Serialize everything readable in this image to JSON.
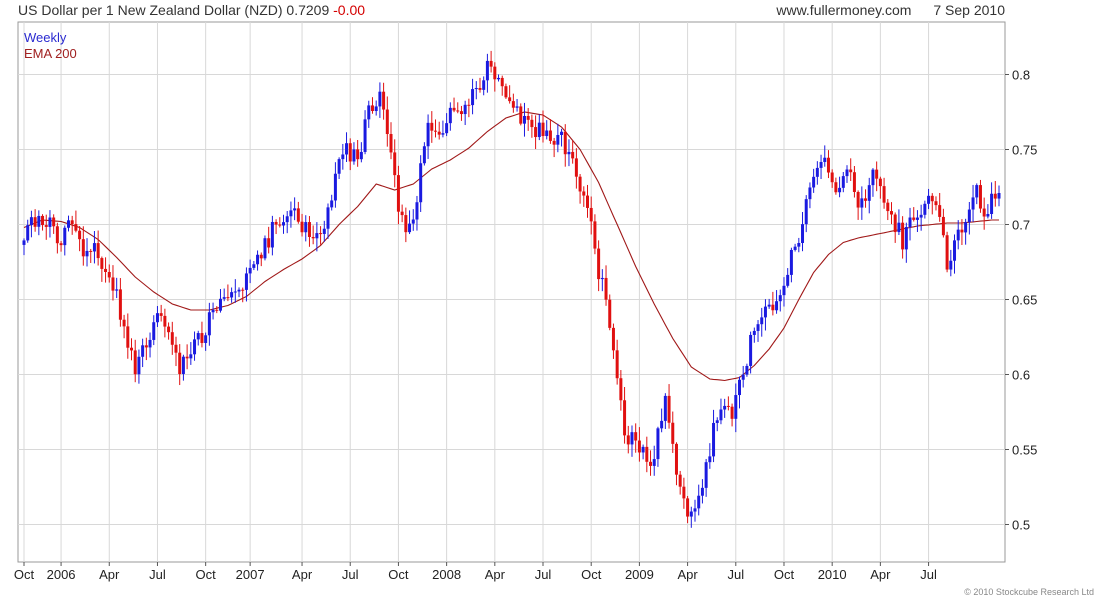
{
  "header": {
    "title_main": "US Dollar per 1 New Zealand Dollar (NZD) 0.7209",
    "title_change": "-0.00",
    "site": "www.fullermoney.com",
    "date": "7 Sep 2010"
  },
  "footer": {
    "copyright": "© 2010 Stockcube Research Ltd"
  },
  "colors": {
    "up": "#1a1ae0",
    "down": "#e01010",
    "ema": "#a01818",
    "grid": "#d8d8d8"
  },
  "chart_data": {
    "type": "candlestick",
    "legend": [
      "Weekly",
      "EMA 200"
    ],
    "ylim": [
      0.475,
      0.835
    ],
    "yticks": [
      0.5,
      0.55,
      0.6,
      0.65,
      0.7,
      0.75,
      0.8
    ],
    "ytick_labels": [
      "0.5",
      "0.55",
      "0.6",
      "0.65",
      "0.7",
      "0.75",
      "0.8"
    ],
    "x_tick_labels": [
      "Oct",
      "2006",
      "Apr",
      "Jul",
      "Oct",
      "2007",
      "Apr",
      "Jul",
      "Oct",
      "2008",
      "Apr",
      "Jul",
      "Oct",
      "2009",
      "Apr",
      "Jul",
      "Oct",
      "2010",
      "Apr",
      "Jul"
    ],
    "series": [
      {
        "name": "Weekly",
        "anchor_closes": [
          [
            0,
            0.695
          ],
          [
            4,
            0.705
          ],
          [
            7,
            0.7
          ],
          [
            10,
            0.69
          ],
          [
            13,
            0.705
          ],
          [
            16,
            0.68
          ],
          [
            19,
            0.69
          ],
          [
            22,
            0.67
          ],
          [
            25,
            0.65
          ],
          [
            28,
            0.62
          ],
          [
            30,
            0.605
          ],
          [
            33,
            0.625
          ],
          [
            36,
            0.64
          ],
          [
            39,
            0.625
          ],
          [
            42,
            0.605
          ],
          [
            45,
            0.615
          ],
          [
            48,
            0.625
          ],
          [
            51,
            0.64
          ],
          [
            54,
            0.65
          ],
          [
            57,
            0.66
          ],
          [
            60,
            0.665
          ],
          [
            63,
            0.675
          ],
          [
            66,
            0.69
          ],
          [
            69,
            0.705
          ],
          [
            72,
            0.71
          ],
          [
            75,
            0.7
          ],
          [
            78,
            0.69
          ],
          [
            81,
            0.7
          ],
          [
            84,
            0.73
          ],
          [
            87,
            0.75
          ],
          [
            90,
            0.74
          ],
          [
            93,
            0.775
          ],
          [
            96,
            0.79
          ],
          [
            98,
            0.76
          ],
          [
            101,
            0.71
          ],
          [
            103,
            0.69
          ],
          [
            106,
            0.72
          ],
          [
            109,
            0.765
          ],
          [
            112,
            0.76
          ],
          [
            115,
            0.78
          ],
          [
            118,
            0.77
          ],
          [
            121,
            0.785
          ],
          [
            124,
            0.795
          ],
          [
            126,
            0.81
          ],
          [
            129,
            0.79
          ],
          [
            132,
            0.78
          ],
          [
            135,
            0.77
          ],
          [
            138,
            0.765
          ],
          [
            141,
            0.76
          ],
          [
            144,
            0.76
          ],
          [
            147,
            0.75
          ],
          [
            150,
            0.72
          ],
          [
            153,
            0.7
          ],
          [
            155,
            0.67
          ],
          [
            157,
            0.65
          ],
          [
            159,
            0.62
          ],
          [
            161,
            0.58
          ],
          [
            163,
            0.55
          ],
          [
            165,
            0.56
          ],
          [
            167,
            0.545
          ],
          [
            169,
            0.54
          ],
          [
            171,
            0.56
          ],
          [
            173,
            0.58
          ],
          [
            175,
            0.55
          ],
          [
            177,
            0.53
          ],
          [
            179,
            0.51
          ],
          [
            181,
            0.505
          ],
          [
            183,
            0.52
          ],
          [
            185,
            0.55
          ],
          [
            187,
            0.575
          ],
          [
            189,
            0.585
          ],
          [
            191,
            0.575
          ],
          [
            193,
            0.59
          ],
          [
            195,
            0.61
          ],
          [
            197,
            0.63
          ],
          [
            199,
            0.64
          ],
          [
            201,
            0.64
          ],
          [
            203,
            0.65
          ],
          [
            205,
            0.665
          ],
          [
            207,
            0.68
          ],
          [
            209,
            0.69
          ],
          [
            211,
            0.71
          ],
          [
            213,
            0.73
          ],
          [
            215,
            0.745
          ],
          [
            217,
            0.74
          ],
          [
            219,
            0.72
          ],
          [
            221,
            0.735
          ],
          [
            223,
            0.73
          ],
          [
            225,
            0.715
          ],
          [
            227,
            0.72
          ],
          [
            229,
            0.735
          ],
          [
            231,
            0.725
          ],
          [
            233,
            0.715
          ],
          [
            235,
            0.7
          ],
          [
            237,
            0.69
          ],
          [
            239,
            0.7
          ],
          [
            241,
            0.71
          ],
          [
            243,
            0.715
          ],
          [
            245,
            0.72
          ],
          [
            247,
            0.705
          ],
          [
            249,
            0.675
          ],
          [
            251,
            0.69
          ],
          [
            253,
            0.7
          ],
          [
            255,
            0.715
          ],
          [
            257,
            0.73
          ],
          [
            259,
            0.705
          ],
          [
            261,
            0.715
          ],
          [
            263,
            0.721
          ]
        ]
      },
      {
        "name": "EMA 200",
        "points": [
          [
            0,
            0.698
          ],
          [
            5,
            0.703
          ],
          [
            10,
            0.702
          ],
          [
            15,
            0.698
          ],
          [
            20,
            0.69
          ],
          [
            25,
            0.678
          ],
          [
            30,
            0.665
          ],
          [
            35,
            0.655
          ],
          [
            40,
            0.647
          ],
          [
            45,
            0.643
          ],
          [
            50,
            0.643
          ],
          [
            55,
            0.646
          ],
          [
            60,
            0.652
          ],
          [
            65,
            0.662
          ],
          [
            70,
            0.67
          ],
          [
            75,
            0.677
          ],
          [
            80,
            0.686
          ],
          [
            85,
            0.7
          ],
          [
            90,
            0.712
          ],
          [
            95,
            0.727
          ],
          [
            100,
            0.723
          ],
          [
            105,
            0.727
          ],
          [
            110,
            0.737
          ],
          [
            115,
            0.743
          ],
          [
            120,
            0.751
          ],
          [
            125,
            0.762
          ],
          [
            130,
            0.771
          ],
          [
            135,
            0.775
          ],
          [
            140,
            0.773
          ],
          [
            145,
            0.765
          ],
          [
            150,
            0.75
          ],
          [
            155,
            0.728
          ],
          [
            160,
            0.7
          ],
          [
            165,
            0.672
          ],
          [
            170,
            0.647
          ],
          [
            175,
            0.624
          ],
          [
            180,
            0.605
          ],
          [
            185,
            0.597
          ],
          [
            189,
            0.596
          ],
          [
            193,
            0.598
          ],
          [
            197,
            0.606
          ],
          [
            201,
            0.617
          ],
          [
            205,
            0.631
          ],
          [
            209,
            0.65
          ],
          [
            213,
            0.668
          ],
          [
            217,
            0.68
          ],
          [
            221,
            0.688
          ],
          [
            225,
            0.691
          ],
          [
            229,
            0.693
          ],
          [
            233,
            0.695
          ],
          [
            237,
            0.697
          ],
          [
            241,
            0.699
          ],
          [
            245,
            0.7
          ],
          [
            249,
            0.701
          ],
          [
            253,
            0.701
          ],
          [
            257,
            0.702
          ],
          [
            261,
            0.703
          ],
          [
            263,
            0.703
          ]
        ]
      }
    ]
  }
}
